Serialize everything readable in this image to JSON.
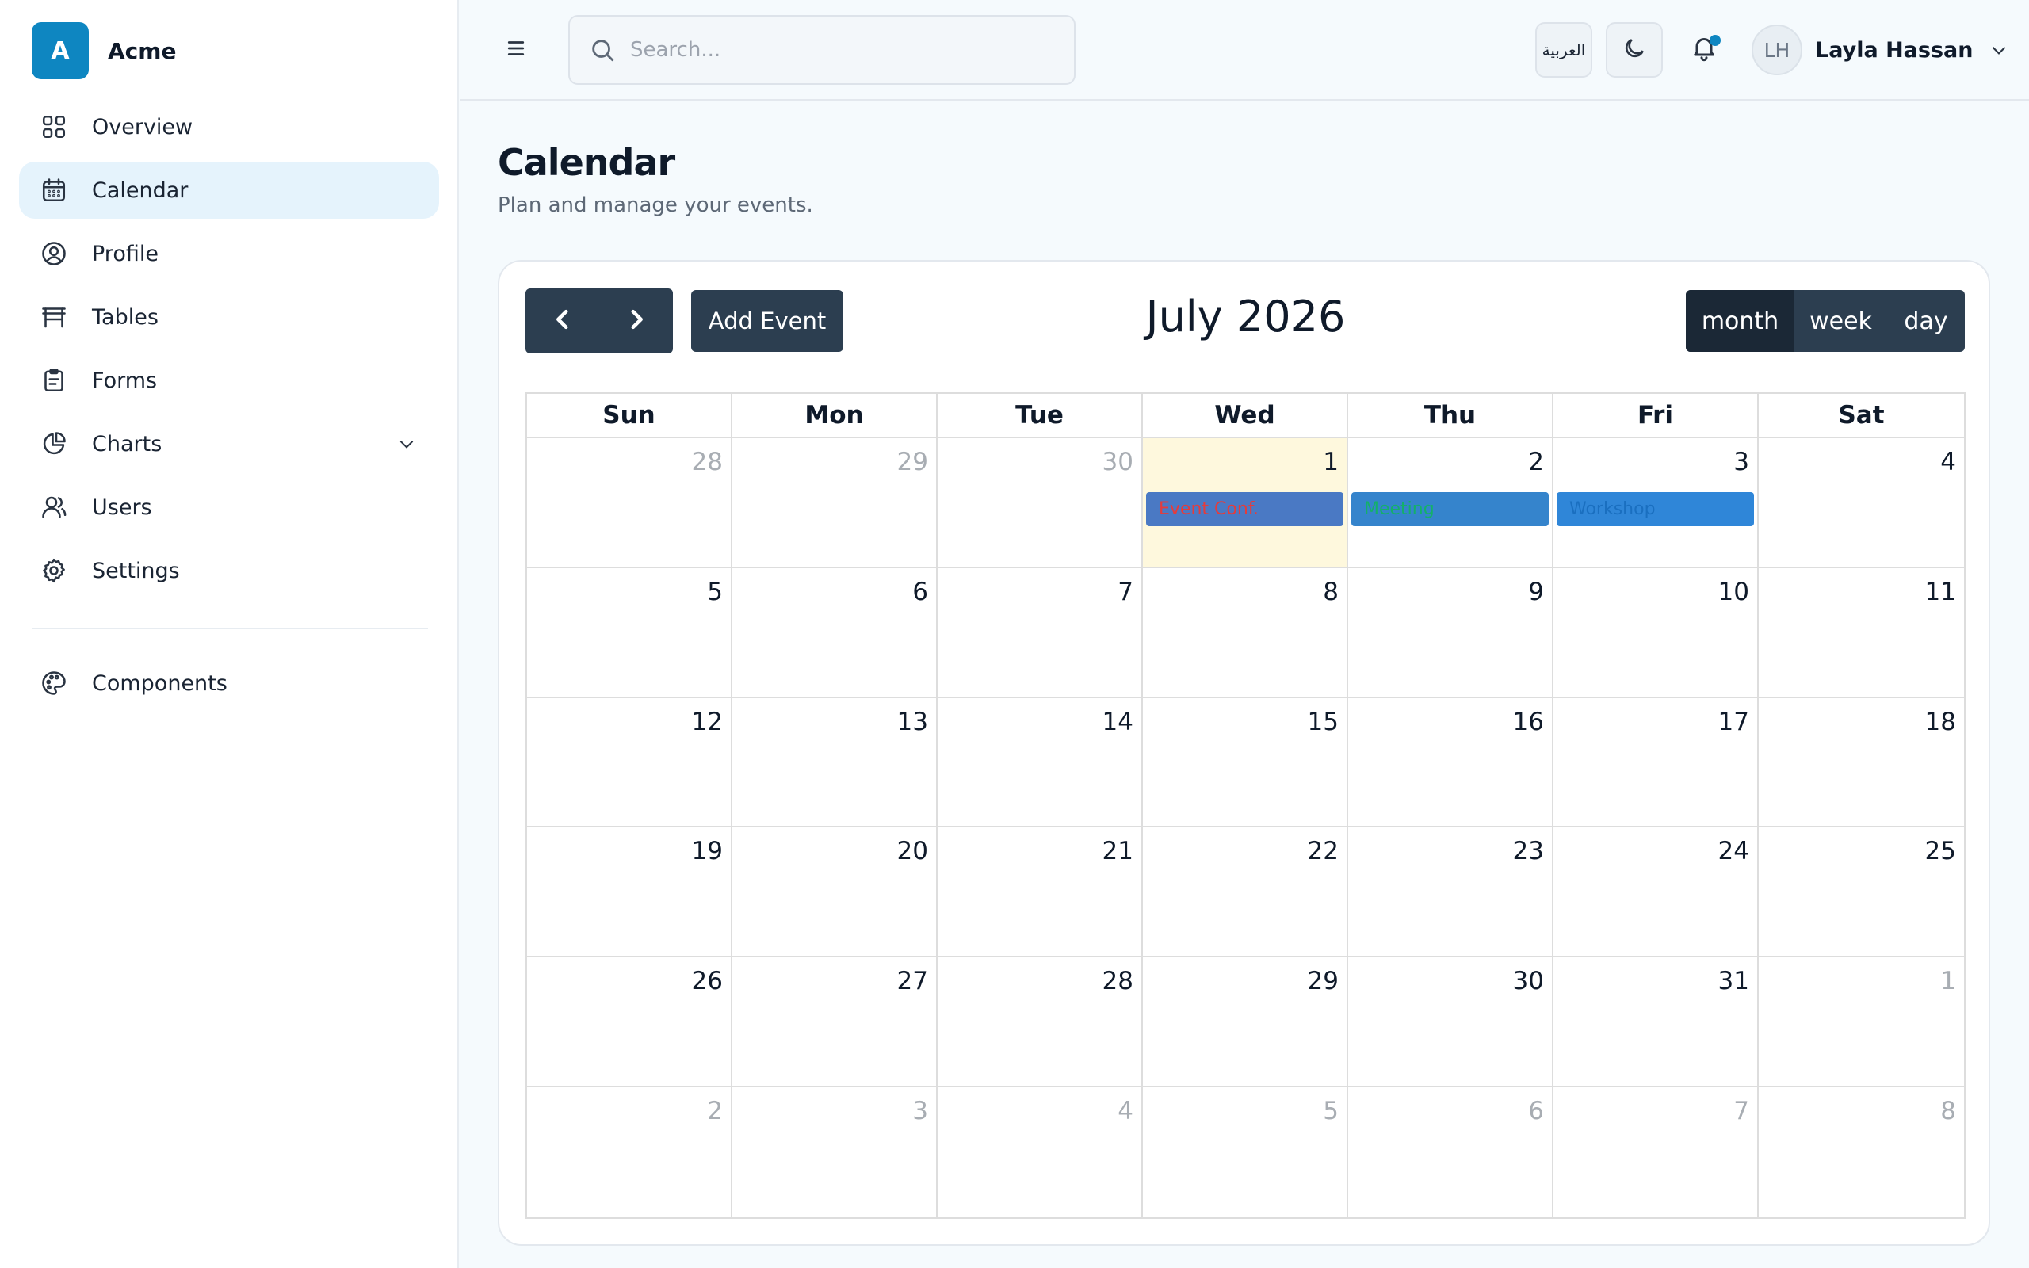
{
  "brand": {
    "logo_letter": "A",
    "name": "Acme"
  },
  "sidebar": {
    "items": [
      {
        "label": "Overview",
        "icon": "grid-icon"
      },
      {
        "label": "Calendar",
        "icon": "calendar-icon",
        "active": true
      },
      {
        "label": "Profile",
        "icon": "user-circle-icon"
      },
      {
        "label": "Tables",
        "icon": "table-icon"
      },
      {
        "label": "Forms",
        "icon": "clipboard-icon"
      },
      {
        "label": "Charts",
        "icon": "pie-chart-icon",
        "has_submenu": true
      },
      {
        "label": "Users",
        "icon": "users-icon"
      },
      {
        "label": "Settings",
        "icon": "gear-icon"
      }
    ],
    "secondary": [
      {
        "label": "Components",
        "icon": "palette-icon"
      }
    ]
  },
  "header": {
    "search_placeholder": "Search...",
    "language_label": "العربية",
    "user": {
      "initials": "LH",
      "name": "Layla Hassan"
    }
  },
  "page": {
    "title": "Calendar",
    "subtitle": "Plan and manage your events."
  },
  "calendar": {
    "title": "July 2026",
    "add_event_label": "Add Event",
    "views": [
      "month",
      "week",
      "day"
    ],
    "active_view": "month",
    "weekdays": [
      "Sun",
      "Mon",
      "Tue",
      "Wed",
      "Thu",
      "Fri",
      "Sat"
    ],
    "days": [
      "28",
      "29",
      "30",
      "1",
      "2",
      "3",
      "4",
      "5",
      "6",
      "7",
      "8",
      "9",
      "10",
      "11",
      "12",
      "13",
      "14",
      "15",
      "16",
      "17",
      "18",
      "19",
      "20",
      "21",
      "22",
      "23",
      "24",
      "25",
      "26",
      "27",
      "28",
      "29",
      "30",
      "31",
      "1",
      "2",
      "3",
      "4",
      "5",
      "6",
      "7",
      "8"
    ],
    "events": [
      {
        "title": "Event Conf.",
        "cell": 3,
        "bg": "#4a79c4",
        "color": "#e63b3b"
      },
      {
        "title": "Meeting",
        "cell": 4,
        "bg": "#3584cc",
        "color": "#14b06a"
      },
      {
        "title": "Workshop",
        "cell": 5,
        "bg": "#2f86d8",
        "color": "#1a6fc0"
      }
    ],
    "today_cell": 3
  },
  "colors": {
    "accent": "#0e86c1",
    "toolbar_button": "#2c3e50",
    "today_bg": "#fef8dd",
    "active_nav_bg": "#e5f3fc"
  }
}
